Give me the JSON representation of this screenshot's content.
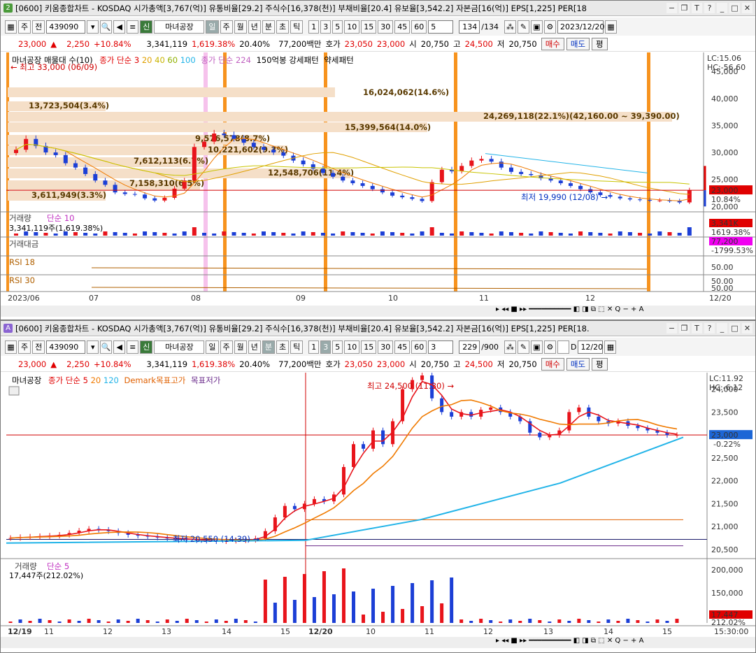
{
  "top": {
    "win_num": "2",
    "title": "[0600] 키움종합차트 - KOSDAQ 시가총액[3,767(억)] 유통비율[29.2] 주식수[16,378(천)] 부채비율[20.4] 유보율[3,542.2] 자본금[16(억)] EPS[1,225] PER[18",
    "toolbar": {
      "market": "주",
      "stock_type": "전",
      "code": "439090",
      "name": "마녀공장",
      "periods": [
        "일",
        "주",
        "월",
        "년",
        "분",
        "초",
        "틱"
      ],
      "mins": [
        "1",
        "3",
        "5",
        "10",
        "15",
        "30",
        "45",
        "60"
      ],
      "n": "5",
      "count": "134",
      "total": "/134",
      "date": "2023/12/20"
    },
    "quote": {
      "price": "23,000",
      "arrow": "▲",
      "change": "2,250",
      "pct": "+10.84%",
      "volume": "3,341,119",
      "vol_pct": "1,619.38%",
      "turnover": "20.40%",
      "amount": "77,200백만",
      "hoga_label": "호가",
      "hoga1": "23,050",
      "hoga2": "23,000",
      "open_label": "시",
      "open": "20,750",
      "high_label": "고",
      "high": "24,500",
      "low_label": "저",
      "low": "20,750",
      "buy": "매수",
      "sell": "매도",
      "avg": "평"
    },
    "legend": {
      "stock": "마녀공장 매물대 수(10)",
      "ma": "종가 단순 3",
      "ma_periods": [
        "20",
        "40",
        "60",
        "100"
      ],
      "ma2": "종가 단순 224",
      "pattern": "150억봉 강세패턴",
      "pattern2": "약세패턴"
    },
    "annotations": {
      "high": "최고 33,000 (06/09)",
      "low": "최저 19,990 (12/08)",
      "lc": "LC:15.06",
      "hc": "HC:-56.60",
      "price_tag": "23,000",
      "pct_tag": "10.84%"
    },
    "profile": [
      "16,024,062(14.6%)",
      "13,723,504(3.4%)",
      "24,269,118(22.1%)(42,160.00 ~ 39,390.00)",
      "15,399,564(14.0%)",
      "9,576,578(8.7%)",
      "10,221,602(9.3%)",
      "7,612,113(6.7%)",
      "12,548,706(11.4%)",
      "7,158,310(6.5%)",
      "3,611,949(3.3%)"
    ],
    "yaxis": [
      "45,000",
      "40,000",
      "35,000",
      "30,000",
      "25,000",
      "20,000"
    ],
    "volume": {
      "label": "거래량",
      "ind": "단순 10",
      "value": "3,341,119주(1,619.38%)",
      "tag1": "3,341K",
      "tag2": "1619.38%"
    },
    "amount": {
      "label": "거래대금",
      "tag1": "77,200",
      "tag2": "-1799.53%"
    },
    "rsi1": {
      "label": "RSI 18",
      "v1": "50.00"
    },
    "rsi2": {
      "label": "RSI 30",
      "v1": "50.00",
      "v2": "50.00"
    },
    "xaxis": [
      "2023/06",
      "07",
      "08",
      "09",
      "10",
      "11",
      "12",
      "12/20"
    ]
  },
  "bottom": {
    "win_num": "A",
    "title": "[0600] 키움종합차트 - KOSDAQ 시가총액[3,767(억)] 유통비율[29.2] 주식수[16,378(천)] 부채비율[20.4] 유보율[3,542.2] 자본금[16(억)] EPS[1,225] PER[18.",
    "toolbar": {
      "market": "주",
      "stock_type": "전",
      "code": "439090",
      "name": "마녀공장",
      "periods": [
        "일",
        "주",
        "월",
        "년",
        "분",
        "초",
        "틱"
      ],
      "mins": [
        "1",
        "3",
        "5",
        "10",
        "15",
        "30",
        "45",
        "60"
      ],
      "n": "3",
      "count": "229",
      "total": "/900",
      "d": "D",
      "date": "12/20"
    },
    "legend": {
      "stock": "마녀공장",
      "ma": "종가 단순 5",
      "ma_periods": [
        "20",
        "120"
      ],
      "demark_hi": "Demark목표고가",
      "demark_lo": "목표저가"
    },
    "annotations": {
      "high": "최고 24,500 (11:30)",
      "low": "최저 20,550 (14:39)",
      "lc": "LC:11.92",
      "hc": "HC:-6.12",
      "price_tag": "23,000",
      "pct_tag": "-0.22%"
    },
    "yaxis": [
      "24,000",
      "23,500",
      "23,000",
      "22,500",
      "22,000",
      "21,500",
      "21,000",
      "20,500"
    ],
    "volume": {
      "label": "거래량",
      "ind": "단순 5",
      "value": "17,447주(212.02%)",
      "tag1": "17,447",
      "tag2": "212.02%",
      "yaxis": [
        "200,000",
        "150,000",
        "100,000"
      ]
    },
    "xaxis": [
      "12/19",
      "11",
      "12",
      "13",
      "14",
      "15",
      "12/20",
      "10",
      "11",
      "12",
      "13",
      "14",
      "15"
    ],
    "time": "15:30:00"
  },
  "colors": {
    "up": "#e8141b",
    "down": "#1c3fd6",
    "orange": "#f7931e",
    "profile": "#f5dfc8",
    "ma_orange": "#f07a00",
    "ma_cyan": "#22b4e8",
    "pink": "#f6c2ec"
  },
  "chart_data": [
    {
      "type": "candlestick",
      "title": "마녀공장 일봉",
      "x": [
        "06",
        "07",
        "08",
        "09",
        "10",
        "11",
        "12",
        "12/20"
      ],
      "ylim": [
        19000,
        48000
      ],
      "closes": [
        30500,
        32500,
        31200,
        30000,
        29500,
        28000,
        27200,
        26000,
        24800,
        24000,
        22600,
        22300,
        22200,
        21500,
        21100,
        21600,
        23300,
        24800,
        31000,
        32000,
        33500,
        33200,
        32500,
        31800,
        31000,
        30500,
        30000,
        29400,
        28500,
        27800,
        27000,
        26200,
        25500,
        24800,
        24300,
        23800,
        23200,
        22600,
        22000,
        21700,
        21400,
        21000,
        24500,
        26800,
        26500,
        27500,
        28500,
        28800,
        28300,
        27200,
        26400,
        26000,
        25800,
        25200,
        24800,
        24300,
        23800,
        23200,
        22600,
        22100,
        21800,
        21500,
        21300,
        21200,
        21100,
        21100,
        21000,
        20750,
        23000
      ],
      "high": "33,000 (06/09)",
      "low": "19,990 (12/08)",
      "last": 23000
    },
    {
      "type": "candlestick",
      "title": "마녀공장 3분봉",
      "x": [
        "12/19",
        "11",
        "12",
        "13",
        "14",
        "15",
        "12/20",
        "10",
        "11",
        "12",
        "13",
        "14",
        "15"
      ],
      "ylim": [
        20300,
        24300
      ],
      "closes": [
        20750,
        20770,
        20780,
        20790,
        20800,
        20820,
        20860,
        20910,
        20950,
        20930,
        20900,
        20860,
        20820,
        20800,
        20780,
        20760,
        20740,
        20730,
        20720,
        20700,
        20690,
        20680,
        20690,
        20700,
        20710,
        20740,
        20900,
        21200,
        21450,
        21380,
        21500,
        21600,
        21550,
        21700,
        22300,
        22800,
        22700,
        23100,
        22800,
        23300,
        24000,
        24200,
        24300,
        23800,
        23500,
        23400,
        23500,
        23400,
        23550,
        23600,
        23500,
        23400,
        23300,
        23050,
        22950,
        23000,
        23100,
        23500,
        23600,
        23400,
        23300,
        23250,
        23300,
        23200,
        23150,
        23100,
        23050,
        23000,
        23000
      ],
      "high": "24,500 (11:30)",
      "low": "20,550 (14:39)",
      "last": 23000
    }
  ]
}
